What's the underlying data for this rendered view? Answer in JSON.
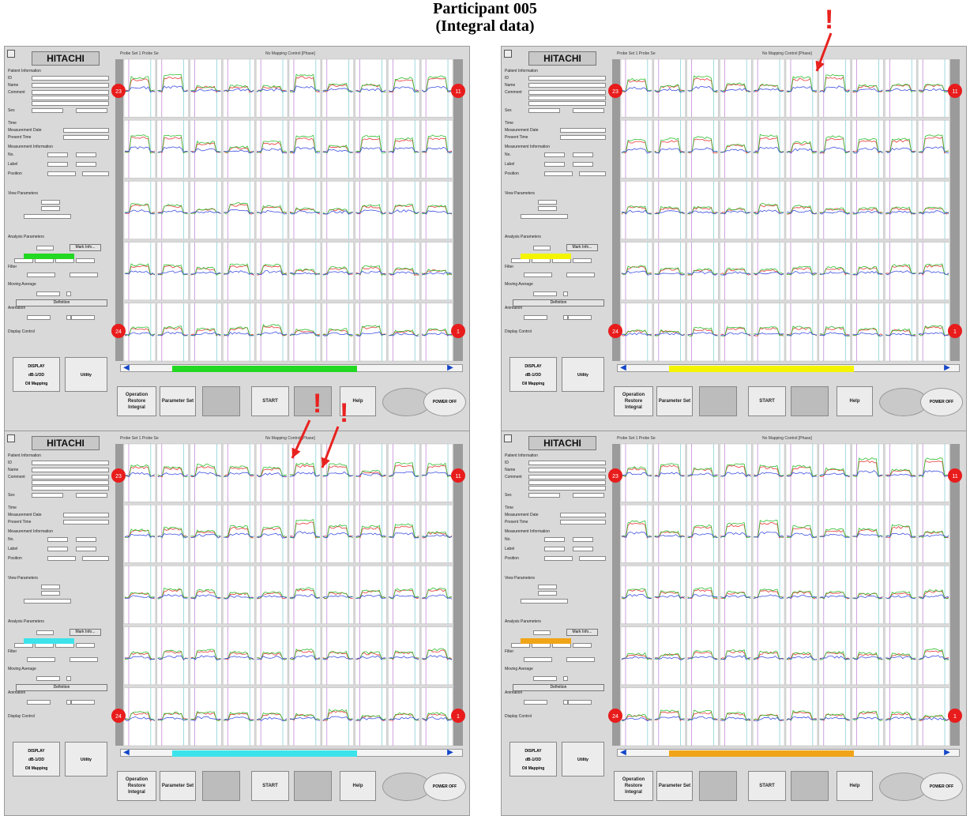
{
  "figure": {
    "title_line1": "Participant 005",
    "title_line2": "(Integral data)"
  },
  "colors": {
    "red_line": "#e8383a",
    "green_line": "#2fbf2f",
    "blue_line": "#4050e0",
    "marker_red": "#e81c1c",
    "annotation_red": "#e8221f",
    "panel_bg": "#d9d9d9"
  },
  "common": {
    "logo": "HITACHI",
    "left_labels": [
      "Patient Information",
      "ID",
      "Name",
      "Comment",
      "Sex",
      "Time",
      "Measurement Date",
      "Present Time",
      "Measurement Information",
      "No.",
      "Label",
      "Position",
      "View Parameters",
      "Analysis Parameters",
      "Filter",
      "Moving Average",
      "Animation",
      "Display Control"
    ],
    "buttons": {
      "mark_info": "Mark Info...",
      "definition": "Definition",
      "display": "DISPLAY",
      "display2": "dB-1/OD",
      "display3": "Oil Mapping",
      "utility": "Utility",
      "operation": "Operation",
      "operation2": "Restore",
      "operation3": "Integral",
      "parameter_set": "Parameter Set",
      "start": "START",
      "help": "Help",
      "power_off": "POWER OFF"
    },
    "legend_left": "Probe Set 1   Probe Se",
    "legend_mid": "No Mapping Control [Phase]",
    "corner_markers": [
      "23",
      "11",
      "24",
      "1"
    ],
    "icons": [
      "window-icon",
      "left-nav-arrow-icon",
      "right-nav-arrow-icon"
    ]
  },
  "panels": [
    {
      "id": "top-left",
      "bar_color": "#22d822",
      "progress_color": "#22d822",
      "progress": 0.55,
      "annotation": false
    },
    {
      "id": "top-right",
      "bar_color": "#f4f400",
      "progress_color": "#f4f400",
      "progress": 0.55,
      "annotation": true
    },
    {
      "id": "bottom-left",
      "bar_color": "#3ce3ea",
      "progress_color": "#3ce3ea",
      "progress": 0.55,
      "annotation": true
    },
    {
      "id": "bottom-right",
      "bar_color": "#f0a418",
      "progress_color": "#f0a418",
      "progress": 0.55,
      "annotation": false
    }
  ],
  "annotations": [
    {
      "mark": "!",
      "target": "top-right-channel-5"
    },
    {
      "mark": "!",
      "target": "bottom-left-channel-4"
    },
    {
      "mark": "!",
      "target": "bottom-left-channel-5"
    }
  ]
}
